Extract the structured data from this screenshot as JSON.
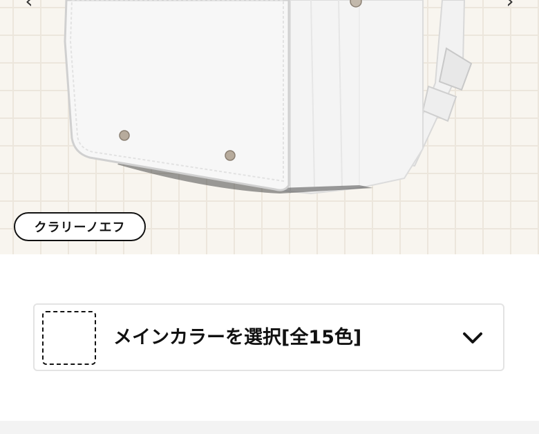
{
  "hero": {
    "image_subject": "white randoseru school backpack",
    "model_name": "クラリーノエフ",
    "prev_icon": "chevron-left-icon",
    "next_icon": "chevron-right-icon",
    "background_color": "#f8f5ef",
    "grid_color": "#ece6dc"
  },
  "color_selector": {
    "label": "メインカラーを選択[全15色]",
    "dropdown_icon": "chevron-down-icon",
    "border_color": "#e3e3e3"
  },
  "footer": {
    "background_color": "#f3f3f3"
  }
}
